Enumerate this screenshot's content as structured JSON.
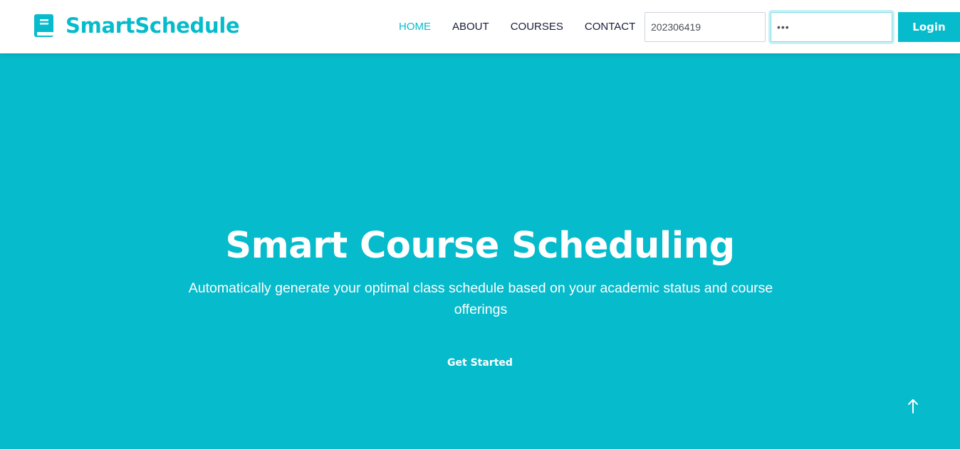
{
  "brand": {
    "name": "SmartSchedule",
    "icon": "book-icon",
    "color": "#06bbcc"
  },
  "nav": {
    "items": [
      {
        "label": "HOME",
        "active": true
      },
      {
        "label": "ABOUT",
        "active": false
      },
      {
        "label": "COURSES",
        "active": false
      },
      {
        "label": "CONTACT",
        "active": false
      }
    ]
  },
  "login": {
    "username_value": "202306419",
    "password_value": "•••",
    "button_label": "Login"
  },
  "hero": {
    "title": "Smart Course Scheduling",
    "subtitle": "Automatically generate your optimal class schedule based on your academic status and course offerings",
    "cta_label": "Get Started",
    "background": "#06bbcc"
  },
  "back_to_top": {
    "icon": "arrow-up-icon"
  }
}
